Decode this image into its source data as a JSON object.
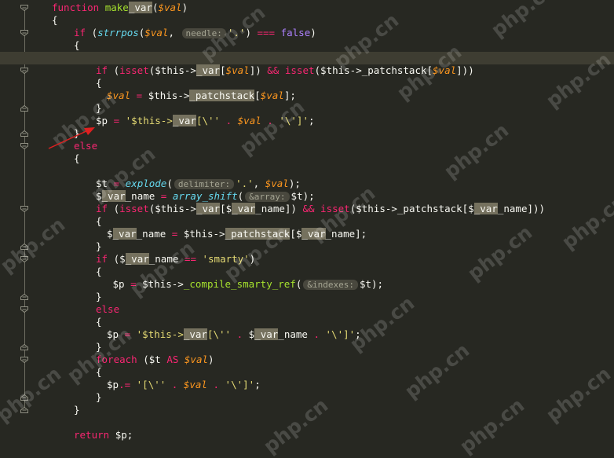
{
  "editor": {
    "theme_colors": {
      "background": "#272822",
      "keyword": "#f92672",
      "variable": "#fd971f",
      "function_name": "#a6e22e",
      "builtin_call": "#66d9ef",
      "string": "#e6db74",
      "boolean": "#ae81ff",
      "match_highlight": "#75715e",
      "annotation_arrow": "#e02020"
    },
    "lines": [
      {
        "indent": 0,
        "tokens": [
          {
            "t": "function ",
            "c": "kw"
          },
          {
            "t": "make",
            "c": "fn"
          },
          {
            "t": "_var",
            "c": "hl"
          },
          {
            "t": "(",
            "c": "pl"
          },
          {
            "t": "$val",
            "c": "var"
          },
          {
            "t": ")",
            "c": "pl"
          }
        ]
      },
      {
        "indent": 0,
        "tokens": [
          {
            "t": "{",
            "c": "pl"
          }
        ]
      },
      {
        "indent": 2,
        "tokens": [
          {
            "t": "if ",
            "c": "kw"
          },
          {
            "t": "(",
            "c": "pl"
          },
          {
            "t": "strrpos",
            "c": "call"
          },
          {
            "t": "(",
            "c": "pl"
          },
          {
            "t": "$val",
            "c": "var"
          },
          {
            "t": ", ",
            "c": "pl"
          },
          {
            "t": "needle:",
            "c": "hint"
          },
          {
            "t": "'.'",
            "c": "str"
          },
          {
            "t": ") ",
            "c": "pl"
          },
          {
            "t": "=== ",
            "c": "op"
          },
          {
            "t": "false",
            "c": "bool"
          },
          {
            "t": ")",
            "c": "pl"
          }
        ]
      },
      {
        "indent": 2,
        "tokens": [
          {
            "t": "{",
            "c": "pl"
          }
        ]
      },
      {
        "indent": 0,
        "current": true,
        "tokens": []
      },
      {
        "indent": 4,
        "tokens": [
          {
            "t": "if ",
            "c": "kw"
          },
          {
            "t": "(",
            "c": "pl"
          },
          {
            "t": "isset",
            "c": "kw"
          },
          {
            "t": "($this->",
            "c": "pl"
          },
          {
            "t": "_var",
            "c": "hl"
          },
          {
            "t": "[",
            "c": "pl"
          },
          {
            "t": "$val",
            "c": "var"
          },
          {
            "t": "]) ",
            "c": "pl"
          },
          {
            "t": "&& ",
            "c": "op"
          },
          {
            "t": "isset",
            "c": "kw"
          },
          {
            "t": "($this->_patchstack[",
            "c": "pl"
          },
          {
            "t": "$val",
            "c": "var"
          },
          {
            "t": "]))",
            "c": "pl"
          }
        ]
      },
      {
        "indent": 4,
        "tokens": [
          {
            "t": "{",
            "c": "pl"
          }
        ]
      },
      {
        "indent": 5,
        "tokens": [
          {
            "t": "$val",
            "c": "var"
          },
          {
            "t": " = ",
            "c": "op"
          },
          {
            "t": "$this->",
            "c": "pl"
          },
          {
            "t": "_patchstack",
            "c": "hl"
          },
          {
            "t": "[",
            "c": "pl"
          },
          {
            "t": "$val",
            "c": "var"
          },
          {
            "t": "];",
            "c": "pl"
          }
        ]
      },
      {
        "indent": 4,
        "tokens": [
          {
            "t": "}",
            "c": "pl"
          }
        ]
      },
      {
        "indent": 4,
        "tokens": [
          {
            "t": "$p",
            "c": "pl"
          },
          {
            "t": " = ",
            "c": "op"
          },
          {
            "t": "'$this->",
            "c": "str"
          },
          {
            "t": "_var",
            "c": "hl"
          },
          {
            "t": "[\\''",
            "c": "str"
          },
          {
            "t": " . ",
            "c": "op"
          },
          {
            "t": "$val",
            "c": "var"
          },
          {
            "t": " . ",
            "c": "op"
          },
          {
            "t": "'\\']'",
            "c": "str"
          },
          {
            "t": ";",
            "c": "pl"
          }
        ]
      },
      {
        "indent": 2,
        "tokens": [
          {
            "t": "}",
            "c": "pl"
          }
        ]
      },
      {
        "indent": 2,
        "tokens": [
          {
            "t": "else",
            "c": "kw"
          }
        ]
      },
      {
        "indent": 2,
        "tokens": [
          {
            "t": "{",
            "c": "pl"
          }
        ]
      },
      {
        "indent": 0,
        "tokens": []
      },
      {
        "indent": 4,
        "tokens": [
          {
            "t": "$t",
            "c": "pl"
          },
          {
            "t": " = ",
            "c": "op"
          },
          {
            "t": "explode",
            "c": "call"
          },
          {
            "t": "(",
            "c": "pl"
          },
          {
            "t": "delimiter:",
            "c": "hint"
          },
          {
            "t": "'.'",
            "c": "str"
          },
          {
            "t": ", ",
            "c": "pl"
          },
          {
            "t": "$val",
            "c": "var"
          },
          {
            "t": ");",
            "c": "pl"
          }
        ]
      },
      {
        "indent": 4,
        "tokens": [
          {
            "t": "$",
            "c": "pl"
          },
          {
            "t": "_var",
            "c": "hl"
          },
          {
            "t": "_name",
            "c": "pl"
          },
          {
            "t": " = ",
            "c": "op"
          },
          {
            "t": "array_shift",
            "c": "call"
          },
          {
            "t": "(",
            "c": "pl"
          },
          {
            "t": "&array:",
            "c": "hint"
          },
          {
            "t": "$t);",
            "c": "pl"
          }
        ]
      },
      {
        "indent": 4,
        "tokens": [
          {
            "t": "if ",
            "c": "kw"
          },
          {
            "t": "(",
            "c": "pl"
          },
          {
            "t": "isset",
            "c": "kw"
          },
          {
            "t": "($this->",
            "c": "pl"
          },
          {
            "t": "_var",
            "c": "hl"
          },
          {
            "t": "[$",
            "c": "pl"
          },
          {
            "t": "_var",
            "c": "hl"
          },
          {
            "t": "_name]) ",
            "c": "pl"
          },
          {
            "t": "&& ",
            "c": "op"
          },
          {
            "t": "isset",
            "c": "kw"
          },
          {
            "t": "($this->_patchstack[$",
            "c": "pl"
          },
          {
            "t": "_var",
            "c": "hl"
          },
          {
            "t": "_name]))",
            "c": "pl"
          }
        ]
      },
      {
        "indent": 4,
        "tokens": [
          {
            "t": "{",
            "c": "pl"
          }
        ]
      },
      {
        "indent": 5,
        "tokens": [
          {
            "t": "$",
            "c": "pl"
          },
          {
            "t": "_var",
            "c": "hl"
          },
          {
            "t": "_name",
            "c": "pl"
          },
          {
            "t": " = ",
            "c": "op"
          },
          {
            "t": "$this->",
            "c": "pl"
          },
          {
            "t": "_patchstack",
            "c": "hl"
          },
          {
            "t": "[$",
            "c": "pl"
          },
          {
            "t": "_var",
            "c": "hl"
          },
          {
            "t": "_name];",
            "c": "pl"
          }
        ]
      },
      {
        "indent": 4,
        "tokens": [
          {
            "t": "}",
            "c": "pl"
          }
        ]
      },
      {
        "indent": 4,
        "tokens": [
          {
            "t": "if ",
            "c": "kw"
          },
          {
            "t": "($",
            "c": "pl"
          },
          {
            "t": "_var",
            "c": "hl"
          },
          {
            "t": "_name",
            "c": "pl"
          },
          {
            "t": " == ",
            "c": "op"
          },
          {
            "t": "'smarty'",
            "c": "str"
          },
          {
            "t": ")",
            "c": "pl"
          }
        ]
      },
      {
        "indent": 4,
        "tokens": [
          {
            "t": "{",
            "c": "pl"
          }
        ]
      },
      {
        "indent": 5,
        "tokens": [
          {
            "t": " $p",
            "c": "pl"
          },
          {
            "t": " = ",
            "c": "op"
          },
          {
            "t": "$this->",
            "c": "pl"
          },
          {
            "t": "_compile_smarty_ref",
            "c": "fn"
          },
          {
            "t": "(",
            "c": "pl"
          },
          {
            "t": "&indexes:",
            "c": "hint"
          },
          {
            "t": "$t);",
            "c": "pl"
          }
        ]
      },
      {
        "indent": 4,
        "tokens": [
          {
            "t": "}",
            "c": "pl"
          }
        ]
      },
      {
        "indent": 4,
        "tokens": [
          {
            "t": "else",
            "c": "kw"
          }
        ]
      },
      {
        "indent": 4,
        "tokens": [
          {
            "t": "{",
            "c": "pl"
          }
        ]
      },
      {
        "indent": 5,
        "tokens": [
          {
            "t": "$p",
            "c": "pl"
          },
          {
            "t": " = ",
            "c": "op"
          },
          {
            "t": "'$this->",
            "c": "str"
          },
          {
            "t": "_var",
            "c": "hl"
          },
          {
            "t": "[\\''",
            "c": "str"
          },
          {
            "t": " . ",
            "c": "op"
          },
          {
            "t": "$",
            "c": "pl"
          },
          {
            "t": "_var",
            "c": "hl"
          },
          {
            "t": "_name",
            "c": "pl"
          },
          {
            "t": " . ",
            "c": "op"
          },
          {
            "t": "'\\']'",
            "c": "str"
          },
          {
            "t": ";",
            "c": "pl"
          }
        ]
      },
      {
        "indent": 4,
        "tokens": [
          {
            "t": "}",
            "c": "pl"
          }
        ]
      },
      {
        "indent": 4,
        "tokens": [
          {
            "t": "foreach ",
            "c": "kw"
          },
          {
            "t": "($t ",
            "c": "pl"
          },
          {
            "t": "AS ",
            "c": "kw"
          },
          {
            "t": "$val",
            "c": "var"
          },
          {
            "t": ")",
            "c": "pl"
          }
        ]
      },
      {
        "indent": 4,
        "tokens": [
          {
            "t": "{",
            "c": "pl"
          }
        ]
      },
      {
        "indent": 5,
        "tokens": [
          {
            "t": "$p",
            "c": "pl"
          },
          {
            "t": ".= ",
            "c": "op"
          },
          {
            "t": "'[\\''",
            "c": "str"
          },
          {
            "t": " . ",
            "c": "op"
          },
          {
            "t": "$val",
            "c": "var"
          },
          {
            "t": " . ",
            "c": "op"
          },
          {
            "t": "'\\']'",
            "c": "str"
          },
          {
            "t": ";",
            "c": "pl"
          }
        ]
      },
      {
        "indent": 4,
        "tokens": [
          {
            "t": "}",
            "c": "pl"
          }
        ]
      },
      {
        "indent": 2,
        "tokens": [
          {
            "t": "}",
            "c": "pl"
          }
        ]
      },
      {
        "indent": 0,
        "tokens": []
      },
      {
        "indent": 2,
        "tokens": [
          {
            "t": "return ",
            "c": "kw"
          },
          {
            "t": "$p;",
            "c": "pl"
          }
        ]
      }
    ],
    "fold_markers": [
      {
        "line": 0,
        "dir": "open"
      },
      {
        "line": 2,
        "dir": "open"
      },
      {
        "line": 5,
        "dir": "open"
      },
      {
        "line": 8,
        "dir": "close"
      },
      {
        "line": 10,
        "dir": "close"
      },
      {
        "line": 11,
        "dir": "open"
      },
      {
        "line": 16,
        "dir": "open"
      },
      {
        "line": 19,
        "dir": "close"
      },
      {
        "line": 20,
        "dir": "open"
      },
      {
        "line": 23,
        "dir": "close"
      },
      {
        "line": 24,
        "dir": "open"
      },
      {
        "line": 27,
        "dir": "close"
      },
      {
        "line": 28,
        "dir": "open"
      },
      {
        "line": 31,
        "dir": "close"
      },
      {
        "line": 32,
        "dir": "close"
      }
    ]
  },
  "watermark": {
    "text": "php.cn"
  }
}
